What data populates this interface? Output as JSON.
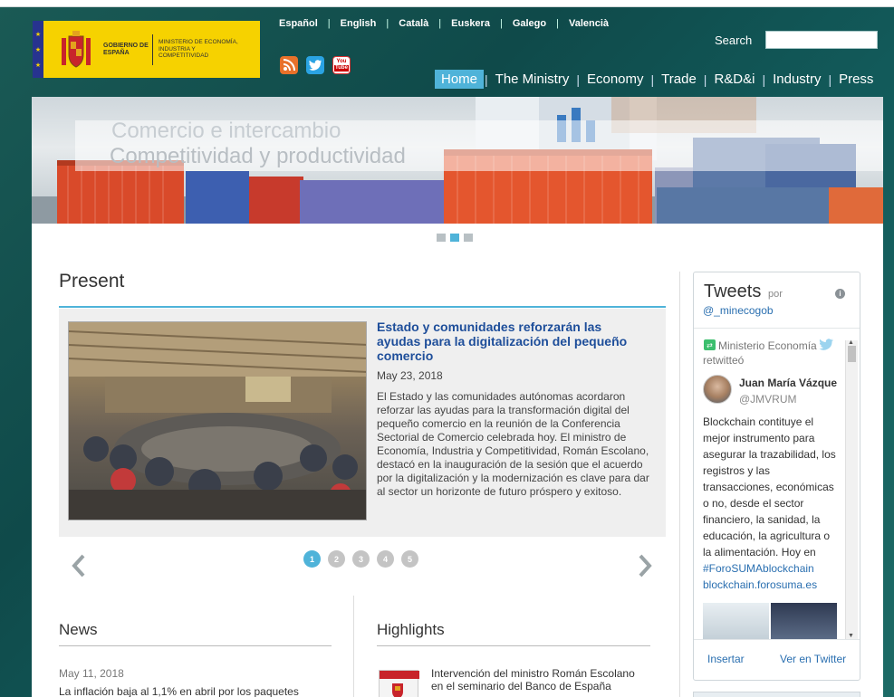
{
  "header": {
    "logo": {
      "gobierno": "GOBIERNO DE ESPAÑA",
      "ministerio": "MINISTERIO DE ECONOMÍA, INDUSTRIA Y COMPETITIVIDAD"
    },
    "languages": [
      "Español",
      "English",
      "Català",
      "Euskera",
      "Galego",
      "Valencià"
    ],
    "search_label": "Search",
    "social": {
      "youtube_top": "You",
      "youtube_bottom": "Tube"
    },
    "nav": [
      "Home",
      "The Ministry",
      "Economy",
      "Trade",
      "R&D&i",
      "Industry",
      "Press"
    ]
  },
  "banner": {
    "caption_line1": "Comercio e intercambio",
    "caption_line2": "Competitividad y productividad"
  },
  "present": {
    "title": "Present",
    "article": {
      "title": "Estado y comunidades reforzarán las ayudas para la digitalización del pequeño comercio",
      "date": "May 23, 2018",
      "body": "El Estado y las comunidades autónomas acordaron reforzar las ayudas para la transformación digital del pequeño comercio en la reunión de la Conferencia Sectorial de Comercio celebrada hoy. El ministro de Economía, Industria y Competitividad, Román Escolano, destacó en la inauguración de la sesión que el acuerdo por la digitalización y la modernización es clave para dar al sector un horizonte de futuro próspero y exitoso."
    },
    "pager": [
      "1",
      "2",
      "3",
      "4",
      "5"
    ]
  },
  "news": {
    "title": "News",
    "date": "May 11, 2018",
    "headline": "La inflación baja al 1,1% en abril por los paquetes"
  },
  "highlights": {
    "title": "Highlights",
    "item": "Intervención del ministro Román Escolano en el seminario del Banco de España"
  },
  "tweets": {
    "title": "Tweets",
    "por": "por",
    "handle": "@_minecogob",
    "retweeter": "Ministerio Economía",
    "retweeted": "retwitteó",
    "author_name": "Juan María Vázquez",
    "author_handle": "@JMVRUM",
    "body": "Blockchain contituye el mejor instrumento para asegurar la trazabilidad, los registros y las transacciones, económicas o no, desde el sector financiero, la sanidad, la educación, la agricultura o la alimentación. Hoy en",
    "hashtag": "#ForoSUMAblockchain",
    "link": "blockchain.forosuma.es",
    "insert": "Insertar",
    "view": "Ver en Twitter"
  }
}
